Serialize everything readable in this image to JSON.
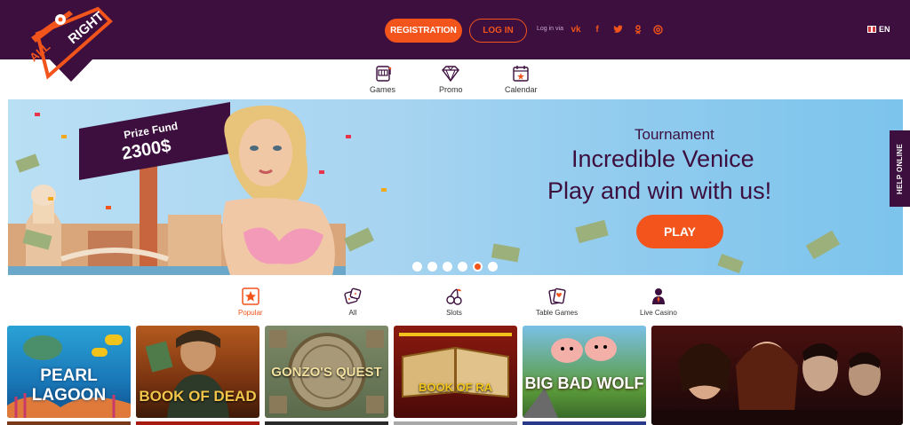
{
  "header": {
    "logo_text_top": "RIGHT",
    "logo_text_bottom": "ALL",
    "registration_label": "REGISTRATION",
    "login_label": "LOG IN",
    "login_via_label": "Log in via",
    "socials": [
      "vk-icon",
      "facebook-icon",
      "twitter-icon",
      "odnoklassniki-icon",
      "mailru-icon"
    ],
    "lang_label": "EN"
  },
  "topnav": [
    {
      "label": "Games",
      "icon": "slot-machine-icon"
    },
    {
      "label": "Promo",
      "icon": "diamond-icon"
    },
    {
      "label": "Calendar",
      "icon": "calendar-icon"
    }
  ],
  "banner": {
    "prize_label": "Prize Fund",
    "prize_value": "2300$",
    "subtitle": "Tournament",
    "title_line1": "Incredible Venice",
    "title_line2": "Play and win with us!",
    "play_label": "PLAY",
    "dots_count": 6,
    "active_dot": 4
  },
  "help_label": "HELP ONLINE",
  "categories": [
    {
      "label": "Popular",
      "icon": "star-icon",
      "active": true
    },
    {
      "label": "All",
      "icon": "dice-icon",
      "active": false
    },
    {
      "label": "Slots",
      "icon": "cherry-icon",
      "active": false
    },
    {
      "label": "Table Games",
      "icon": "cards-icon",
      "active": false
    },
    {
      "label": "Live Casino",
      "icon": "dealer-icon",
      "active": false
    }
  ],
  "games": [
    {
      "title": "PEARL LAGOON"
    },
    {
      "title": "BOOK OF DEAD"
    },
    {
      "title": "GONZO'S QUEST"
    },
    {
      "title": "BOOK OF RA"
    },
    {
      "title": "BIG BAD WOLF"
    },
    {
      "title": ""
    }
  ],
  "colors": {
    "brand_dark": "#3c0f3e",
    "accent": "#f2541b"
  }
}
